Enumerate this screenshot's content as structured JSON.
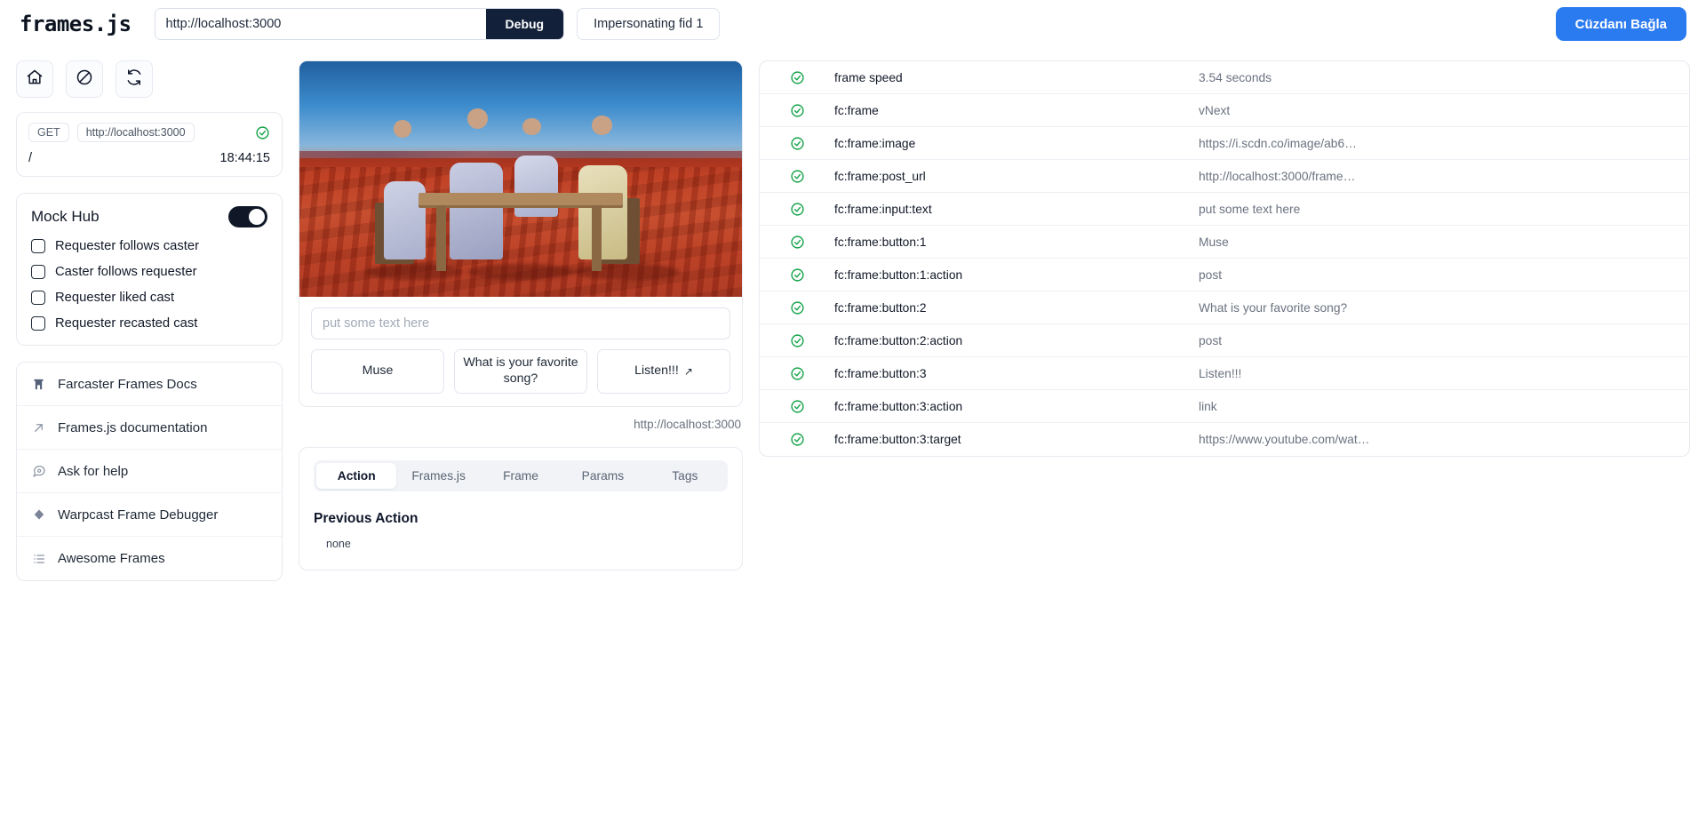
{
  "topbar": {
    "brand": "frames.js",
    "url_value": "http://localhost:3000",
    "url_placeholder": "http://localhost:3000",
    "debug_label": "Debug",
    "impersonate_label": "Impersonating fid 1",
    "connect_label": "Cüzdanı Bağla",
    "connect_color": "#2a7af0"
  },
  "sidebar": {
    "icon_buttons": [
      {
        "name": "home-icon",
        "title": "Home"
      },
      {
        "name": "ban-icon",
        "title": "Clear"
      },
      {
        "name": "refresh-icon",
        "title": "Reload"
      }
    ],
    "request": {
      "method": "GET",
      "url": "http://localhost:3000",
      "path": "/",
      "time": "18:44:15",
      "status": "ok"
    },
    "mock_hub": {
      "title": "Mock Hub",
      "enabled": true,
      "options": [
        {
          "label": "Requester follows caster",
          "checked": false
        },
        {
          "label": "Caster follows requester",
          "checked": false
        },
        {
          "label": "Requester liked cast",
          "checked": false
        },
        {
          "label": "Requester recasted cast",
          "checked": false
        }
      ]
    },
    "links": [
      {
        "label": "Farcaster Frames Docs",
        "icon": "farcaster-icon"
      },
      {
        "label": "Frames.js documentation",
        "icon": "external-link-icon"
      },
      {
        "label": "Ask for help",
        "icon": "chat-bubble-icon"
      },
      {
        "label": "Warpcast Frame Debugger",
        "icon": "diamond-icon"
      },
      {
        "label": "Awesome Frames",
        "icon": "list-icon"
      }
    ]
  },
  "frame": {
    "image_alt": "Four men in patterned suits seated at a table in a red desert under a blue sky",
    "input_placeholder": "put some text here",
    "input_value": "",
    "buttons": [
      {
        "label": "Muse",
        "external": false
      },
      {
        "label": "What is your favorite song?",
        "external": false
      },
      {
        "label": "Listen!!!",
        "external": true
      }
    ],
    "source_url": "http://localhost:3000"
  },
  "tabs": {
    "items": [
      {
        "label": "Action",
        "active": true
      },
      {
        "label": "Frames.js",
        "active": false
      },
      {
        "label": "Frame",
        "active": false
      },
      {
        "label": "Params",
        "active": false
      },
      {
        "label": "Tags",
        "active": false
      }
    ],
    "panel": {
      "title": "Previous Action",
      "body": "none"
    }
  },
  "metadata": {
    "rows": [
      {
        "status": "ok",
        "key": "frame speed",
        "value": "3.54 seconds"
      },
      {
        "status": "ok",
        "key": "fc:frame",
        "value": "vNext"
      },
      {
        "status": "ok",
        "key": "fc:frame:image",
        "value": "https://i.scdn.co/image/ab6…"
      },
      {
        "status": "ok",
        "key": "fc:frame:post_url",
        "value": "http://localhost:3000/frame…"
      },
      {
        "status": "ok",
        "key": "fc:frame:input:text",
        "value": "put some text here"
      },
      {
        "status": "ok",
        "key": "fc:frame:button:1",
        "value": "Muse"
      },
      {
        "status": "ok",
        "key": "fc:frame:button:1:action",
        "value": "post"
      },
      {
        "status": "ok",
        "key": "fc:frame:button:2",
        "value": "What is your favorite song?"
      },
      {
        "status": "ok",
        "key": "fc:frame:button:2:action",
        "value": "post"
      },
      {
        "status": "ok",
        "key": "fc:frame:button:3",
        "value": "Listen!!!"
      },
      {
        "status": "ok",
        "key": "fc:frame:button:3:action",
        "value": "link"
      },
      {
        "status": "ok",
        "key": "fc:frame:button:3:target",
        "value": "https://www.youtube.com/wat…"
      }
    ]
  },
  "colors": {
    "ok_green": "#16a34a",
    "accent": "#2a7af0",
    "dark": "#13203a"
  }
}
